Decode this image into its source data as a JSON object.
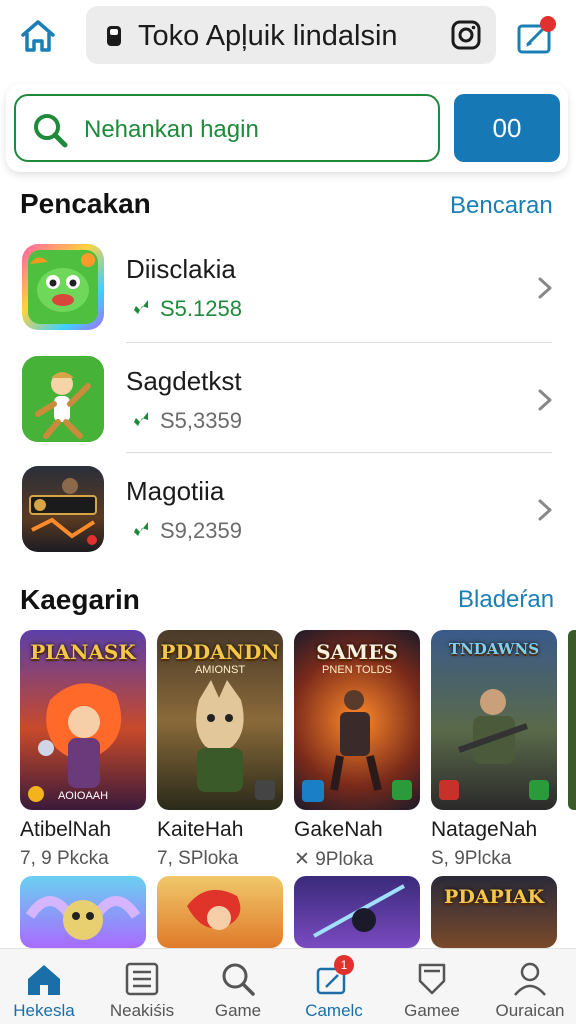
{
  "header": {
    "title": "Toko Apļuik lindalsin",
    "notification_count": "1"
  },
  "search": {
    "placeholder": "Nehankan hagin",
    "button_label": "00"
  },
  "section_recent": {
    "title": "Pencakan",
    "link": "Bencaran",
    "items": [
      {
        "name": "Diisclakia",
        "price": "S5.1258",
        "price_color": "#1f8a3b"
      },
      {
        "name": "Sagdetkst",
        "price": "S5,3359",
        "price_color": "#6b6b6b"
      },
      {
        "name": "Magotiia",
        "price": "S9,2359",
        "price_color": "#6b6b6b"
      }
    ]
  },
  "section_categories": {
    "title": "Kaegarin",
    "link": "Bladeŕan",
    "cards": [
      {
        "art_title": "PIANASK",
        "art_sub": "",
        "art_foot": "AOIOAAH",
        "name": "AtibelNah",
        "sub": "7, 9 Pkcka"
      },
      {
        "art_title": "PDDANDN",
        "art_sub": "AMIONST",
        "art_foot": "",
        "name": "KaiteHah",
        "sub": "7, SPloka"
      },
      {
        "art_title": "SAMES",
        "art_sub": "PNEN TOLDS",
        "art_foot": "",
        "name": "GakeNah",
        "sub": "✕ 9Ploka"
      },
      {
        "art_title": "TNDAWNS",
        "art_sub": "",
        "art_foot": "",
        "name": "NatageNah",
        "sub": "S, 9Plcka"
      }
    ],
    "second_row": [
      {
        "art_title": ""
      },
      {
        "art_title": ""
      },
      {
        "art_title": ""
      },
      {
        "art_title": "PDAPIAK"
      }
    ]
  },
  "bottom_nav": {
    "items": [
      {
        "label": "Hekesla",
        "icon": "home-icon",
        "active": true
      },
      {
        "label": "Neakiśis",
        "icon": "list-icon",
        "active": false
      },
      {
        "label": "Game",
        "icon": "search-icon",
        "active": false
      },
      {
        "label": "Camelc",
        "icon": "edit-icon",
        "active": true,
        "badge": "1"
      },
      {
        "label": "Gamee",
        "icon": "shield-icon",
        "active": false
      },
      {
        "label": "Ouraican",
        "icon": "profile-icon",
        "active": false
      }
    ]
  },
  "colors": {
    "accent_blue": "#1679b5",
    "accent_green": "#1f8a3b",
    "badge_red": "#e0312f"
  }
}
